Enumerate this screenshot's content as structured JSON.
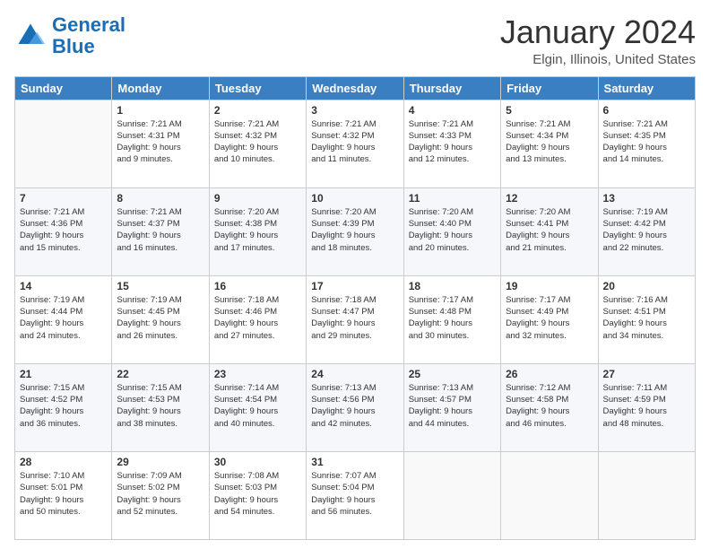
{
  "header": {
    "logo": {
      "line1": "General",
      "line2": "Blue"
    },
    "title": "January 2024",
    "subtitle": "Elgin, Illinois, United States"
  },
  "weekdays": [
    "Sunday",
    "Monday",
    "Tuesday",
    "Wednesday",
    "Thursday",
    "Friday",
    "Saturday"
  ],
  "weeks": [
    [
      {
        "day": null
      },
      {
        "day": "1",
        "sunrise": "7:21 AM",
        "sunset": "4:31 PM",
        "daylight": "9 hours and 9 minutes."
      },
      {
        "day": "2",
        "sunrise": "7:21 AM",
        "sunset": "4:32 PM",
        "daylight": "9 hours and 10 minutes."
      },
      {
        "day": "3",
        "sunrise": "7:21 AM",
        "sunset": "4:32 PM",
        "daylight": "9 hours and 11 minutes."
      },
      {
        "day": "4",
        "sunrise": "7:21 AM",
        "sunset": "4:33 PM",
        "daylight": "9 hours and 12 minutes."
      },
      {
        "day": "5",
        "sunrise": "7:21 AM",
        "sunset": "4:34 PM",
        "daylight": "9 hours and 13 minutes."
      },
      {
        "day": "6",
        "sunrise": "7:21 AM",
        "sunset": "4:35 PM",
        "daylight": "9 hours and 14 minutes."
      }
    ],
    [
      {
        "day": "7",
        "sunrise": "7:21 AM",
        "sunset": "4:36 PM",
        "daylight": "9 hours and 15 minutes."
      },
      {
        "day": "8",
        "sunrise": "7:21 AM",
        "sunset": "4:37 PM",
        "daylight": "9 hours and 16 minutes."
      },
      {
        "day": "9",
        "sunrise": "7:20 AM",
        "sunset": "4:38 PM",
        "daylight": "9 hours and 17 minutes."
      },
      {
        "day": "10",
        "sunrise": "7:20 AM",
        "sunset": "4:39 PM",
        "daylight": "9 hours and 18 minutes."
      },
      {
        "day": "11",
        "sunrise": "7:20 AM",
        "sunset": "4:40 PM",
        "daylight": "9 hours and 20 minutes."
      },
      {
        "day": "12",
        "sunrise": "7:20 AM",
        "sunset": "4:41 PM",
        "daylight": "9 hours and 21 minutes."
      },
      {
        "day": "13",
        "sunrise": "7:19 AM",
        "sunset": "4:42 PM",
        "daylight": "9 hours and 22 minutes."
      }
    ],
    [
      {
        "day": "14",
        "sunrise": "7:19 AM",
        "sunset": "4:44 PM",
        "daylight": "9 hours and 24 minutes."
      },
      {
        "day": "15",
        "sunrise": "7:19 AM",
        "sunset": "4:45 PM",
        "daylight": "9 hours and 26 minutes."
      },
      {
        "day": "16",
        "sunrise": "7:18 AM",
        "sunset": "4:46 PM",
        "daylight": "9 hours and 27 minutes."
      },
      {
        "day": "17",
        "sunrise": "7:18 AM",
        "sunset": "4:47 PM",
        "daylight": "9 hours and 29 minutes."
      },
      {
        "day": "18",
        "sunrise": "7:17 AM",
        "sunset": "4:48 PM",
        "daylight": "9 hours and 30 minutes."
      },
      {
        "day": "19",
        "sunrise": "7:17 AM",
        "sunset": "4:49 PM",
        "daylight": "9 hours and 32 minutes."
      },
      {
        "day": "20",
        "sunrise": "7:16 AM",
        "sunset": "4:51 PM",
        "daylight": "9 hours and 34 minutes."
      }
    ],
    [
      {
        "day": "21",
        "sunrise": "7:15 AM",
        "sunset": "4:52 PM",
        "daylight": "9 hours and 36 minutes."
      },
      {
        "day": "22",
        "sunrise": "7:15 AM",
        "sunset": "4:53 PM",
        "daylight": "9 hours and 38 minutes."
      },
      {
        "day": "23",
        "sunrise": "7:14 AM",
        "sunset": "4:54 PM",
        "daylight": "9 hours and 40 minutes."
      },
      {
        "day": "24",
        "sunrise": "7:13 AM",
        "sunset": "4:56 PM",
        "daylight": "9 hours and 42 minutes."
      },
      {
        "day": "25",
        "sunrise": "7:13 AM",
        "sunset": "4:57 PM",
        "daylight": "9 hours and 44 minutes."
      },
      {
        "day": "26",
        "sunrise": "7:12 AM",
        "sunset": "4:58 PM",
        "daylight": "9 hours and 46 minutes."
      },
      {
        "day": "27",
        "sunrise": "7:11 AM",
        "sunset": "4:59 PM",
        "daylight": "9 hours and 48 minutes."
      }
    ],
    [
      {
        "day": "28",
        "sunrise": "7:10 AM",
        "sunset": "5:01 PM",
        "daylight": "9 hours and 50 minutes."
      },
      {
        "day": "29",
        "sunrise": "7:09 AM",
        "sunset": "5:02 PM",
        "daylight": "9 hours and 52 minutes."
      },
      {
        "day": "30",
        "sunrise": "7:08 AM",
        "sunset": "5:03 PM",
        "daylight": "9 hours and 54 minutes."
      },
      {
        "day": "31",
        "sunrise": "7:07 AM",
        "sunset": "5:04 PM",
        "daylight": "9 hours and 56 minutes."
      },
      {
        "day": null
      },
      {
        "day": null
      },
      {
        "day": null
      }
    ]
  ]
}
